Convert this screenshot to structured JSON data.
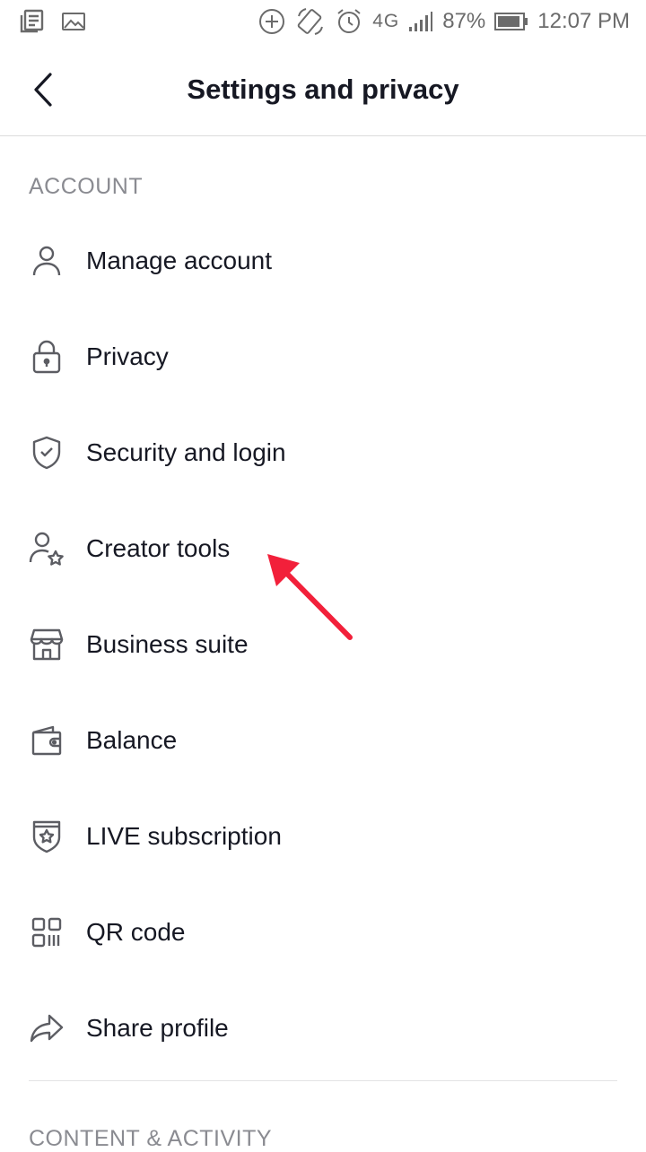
{
  "status_bar": {
    "network": "4G",
    "battery": "87%",
    "time": "12:07 PM"
  },
  "header": {
    "title": "Settings and privacy"
  },
  "sections": [
    {
      "title": "ACCOUNT",
      "items": [
        {
          "label": "Manage account",
          "icon": "person-icon"
        },
        {
          "label": "Privacy",
          "icon": "lock-icon"
        },
        {
          "label": "Security and login",
          "icon": "shield-check-icon"
        },
        {
          "label": "Creator tools",
          "icon": "person-star-icon"
        },
        {
          "label": "Business suite",
          "icon": "storefront-icon"
        },
        {
          "label": "Balance",
          "icon": "wallet-icon"
        },
        {
          "label": "LIVE subscription",
          "icon": "shield-star-icon"
        },
        {
          "label": "QR code",
          "icon": "qr-code-icon"
        },
        {
          "label": "Share profile",
          "icon": "share-arrow-icon"
        }
      ]
    },
    {
      "title": "CONTENT & ACTIVITY"
    }
  ],
  "colors": {
    "text": "#161823",
    "secondary_text": "#8a8b91",
    "icon": "#5c5d63",
    "annotation_arrow": "#f2203a"
  }
}
